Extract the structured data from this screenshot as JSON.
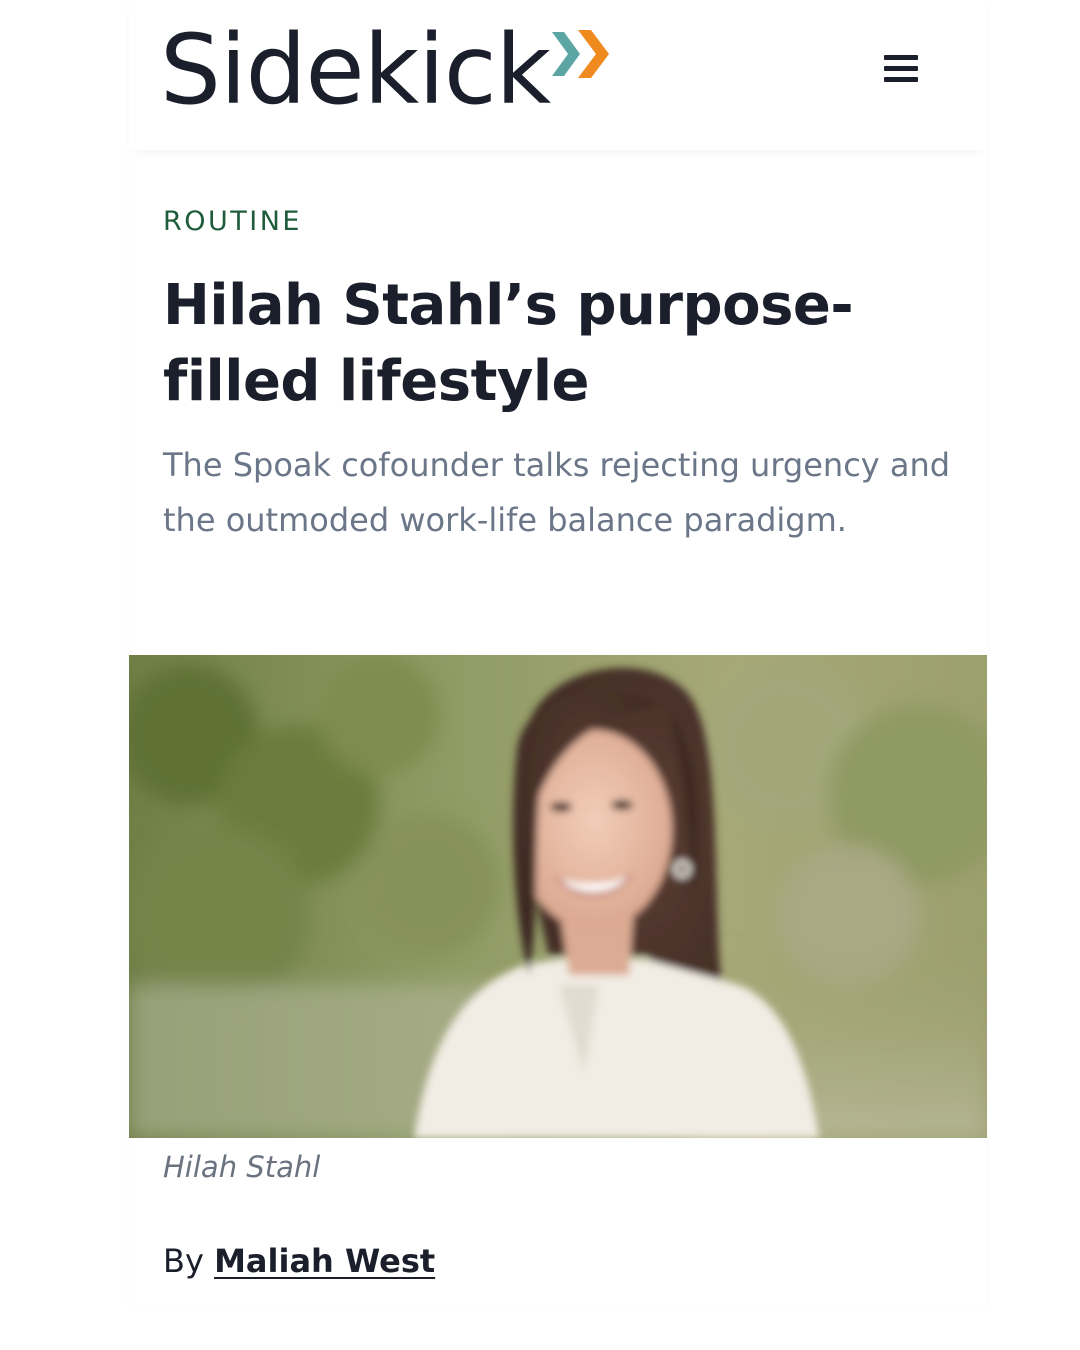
{
  "header": {
    "logo_text": "Sidekick",
    "logo_colors": {
      "chevron_teal": "#5ba6a4",
      "chevron_orange": "#ef8a1f"
    },
    "menu_icon": "hamburger-menu-icon"
  },
  "article": {
    "category": "ROUTINE",
    "category_color": "#1f5c3c",
    "title": "Hilah Stahl’s purpose-filled lifestyle",
    "subtitle": "The Spoak cofounder talks rejecting urgency and the outmoded work-life balance paradigm.",
    "image_caption": "Hilah Stahl",
    "byline_prefix": "By",
    "author": "Maliah West"
  }
}
